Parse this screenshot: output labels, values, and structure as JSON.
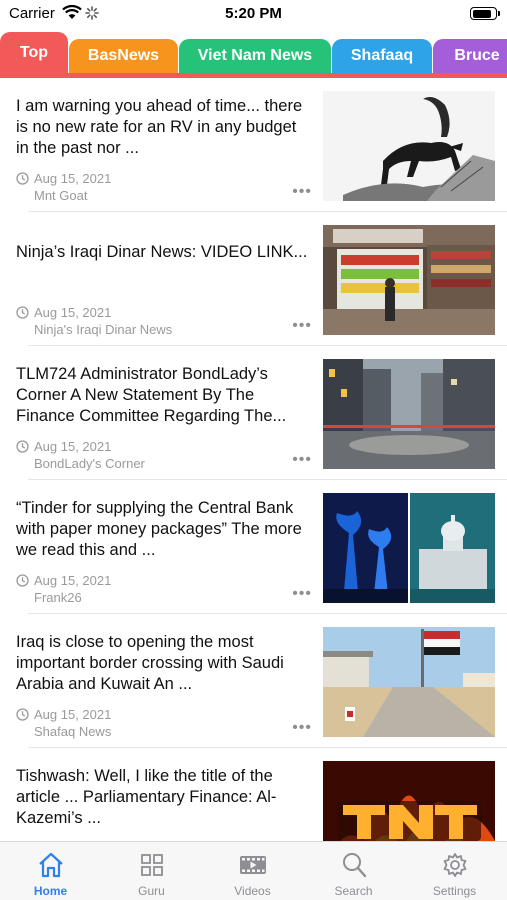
{
  "status": {
    "carrier": "Carrier",
    "time": "5:20 PM",
    "battery_level": 0.9
  },
  "tabs": [
    {
      "label": "Top",
      "color": "#f25a5a",
      "active": true
    },
    {
      "label": "BasNews",
      "color": "#f7941d",
      "active": false
    },
    {
      "label": "Viet Nam News",
      "color": "#27c27a",
      "active": false
    },
    {
      "label": "Shafaaq",
      "color": "#2ea3e8",
      "active": false
    },
    {
      "label": "Bruce",
      "color": "#a45ed9",
      "active": false
    }
  ],
  "articles": [
    {
      "title": "I am warning you ahead of time... there is no new rate for an RV in any budget in the past nor ...",
      "date": "Aug 15, 2021",
      "source": "Mnt Goat",
      "thumb": "goat-illustration"
    },
    {
      "title": "Ninja’s Iraqi Dinar News: VIDEO LINK...",
      "date": "Aug 15, 2021",
      "source": "Ninja's Iraqi Dinar News",
      "thumb": "grocery-store-photo"
    },
    {
      "title": "TLM724 Administrator BondLady’s Corner A New Statement By The Finance Committee Regarding The...",
      "date": "Aug 15, 2021",
      "source": "BondLady's Corner",
      "thumb": "city-street-photo"
    },
    {
      "title": "“Tinder for supplying the Central Bank with paper money packages” The more we read this and ...",
      "date": "Aug 15, 2021",
      "source": "Frank26",
      "thumb": "skyline-and-capitol-photo"
    },
    {
      "title": "Iraq is close to opening the most important border crossing with Saudi Arabia and Kuwait An ...",
      "date": "Aug 15, 2021",
      "source": "Shafaq News",
      "thumb": "border-crossing-flag-photo"
    },
    {
      "title": "Tishwash: Well, I like the title of the article ... Parliamentary Finance: Al-Kazemi’s ...",
      "date": "",
      "source": "",
      "thumb": "tnt-fire-logo"
    }
  ],
  "tabbar": [
    {
      "label": "Home",
      "icon": "home-icon",
      "active": true
    },
    {
      "label": "Guru",
      "icon": "grid-icon",
      "active": false
    },
    {
      "label": "Videos",
      "icon": "film-icon",
      "active": false
    },
    {
      "label": "Search",
      "icon": "search-icon",
      "active": false
    },
    {
      "label": "Settings",
      "icon": "gear-icon",
      "active": false
    }
  ],
  "colors": {
    "accent": "#2f80ed",
    "tab_underline": "#f25a5a",
    "meta_text": "#9a9a9a"
  }
}
